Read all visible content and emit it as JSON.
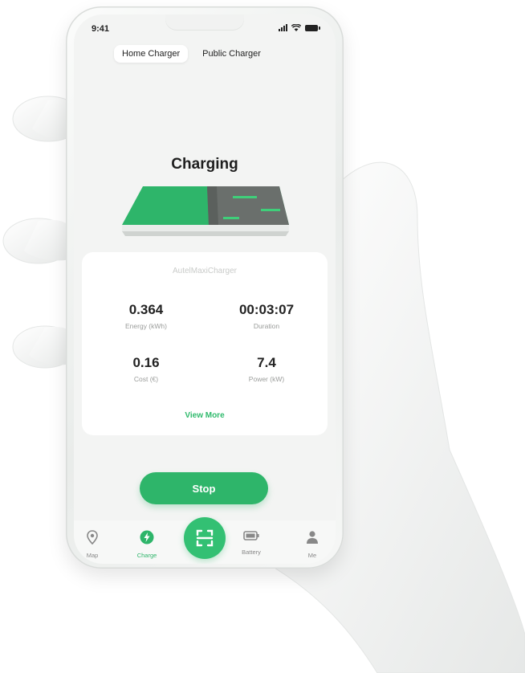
{
  "status_bar": {
    "time": "9:41"
  },
  "tabs": [
    {
      "label": "Home Charger",
      "active": true
    },
    {
      "label": "Public Charger",
      "active": false
    }
  ],
  "charging": {
    "title": "Charging",
    "device_name": "AutelMaxiCharger",
    "stats": [
      {
        "value": "0.364",
        "label": "Energy (kWh)"
      },
      {
        "value": "00:03:07",
        "label": "Duration"
      },
      {
        "value": "0.16",
        "label": "Cost (€)"
      },
      {
        "value": "7.4",
        "label": "Power (kW)"
      }
    ],
    "view_more": "View More"
  },
  "actions": {
    "stop_label": "Stop"
  },
  "nav": {
    "items": [
      {
        "label": "Map",
        "icon": "map-pin-icon"
      },
      {
        "label": "Charge",
        "icon": "charge-icon",
        "active": true
      },
      {
        "label": "",
        "icon": "scan-icon"
      },
      {
        "label": "Battery",
        "icon": "battery-icon"
      },
      {
        "label": "Me",
        "icon": "person-icon"
      }
    ]
  },
  "colors": {
    "accent": "#2eb56a",
    "screen_bg": "#f3f4f3",
    "card_bg": "#ffffff"
  }
}
